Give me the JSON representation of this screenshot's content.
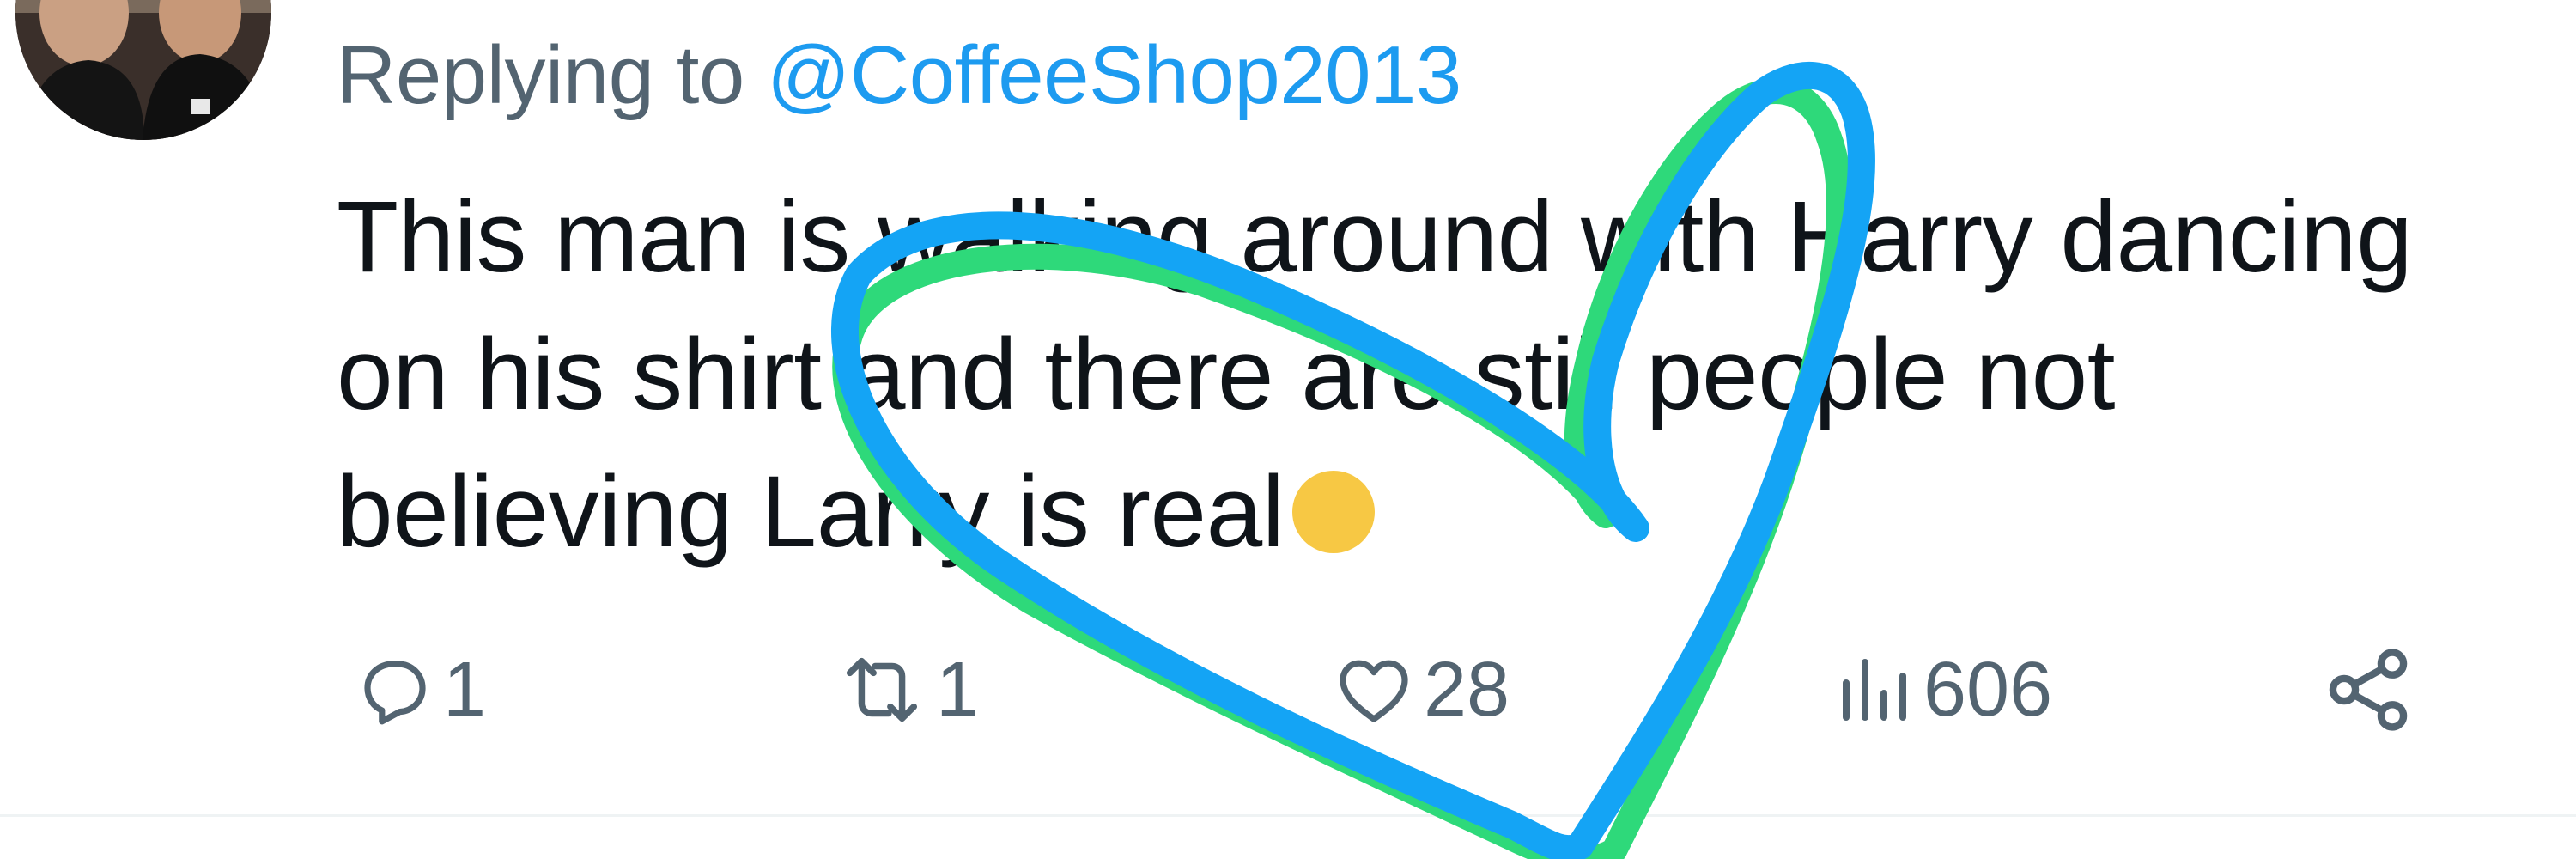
{
  "reply": {
    "prefix": "Replying to",
    "handle": "@CoffeeShop2013"
  },
  "tweet": {
    "text": "This man is walking around with Harry dancing on his shirt and there are still people not believing Larry is real",
    "emoji": "face-emoji"
  },
  "actions": {
    "replies": "1",
    "reposts": "1",
    "likes": "28",
    "views": "606"
  },
  "icons": {
    "reply": "reply-icon",
    "repost": "repost-icon",
    "like": "heart-icon",
    "views": "views-icon",
    "share": "share-icon"
  },
  "colors": {
    "text": "#0f1419",
    "secondary": "#536471",
    "link": "#1d9bf0",
    "doodle_blue": "#14a4f5",
    "doodle_green": "#2ed97a"
  }
}
